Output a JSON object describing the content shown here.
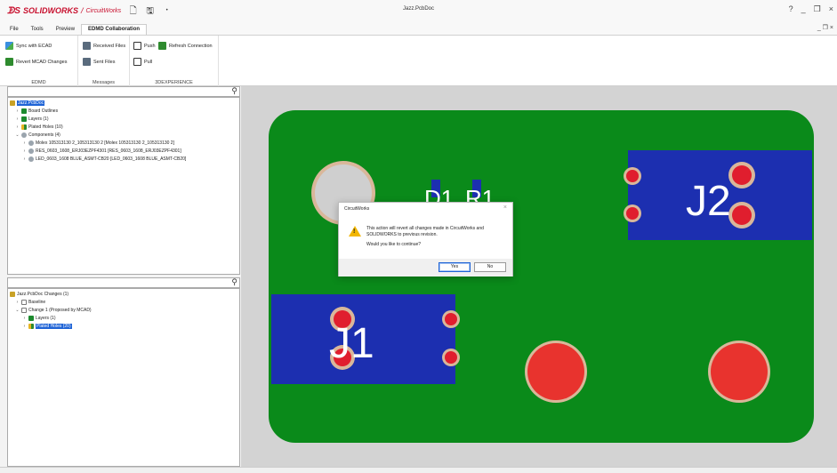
{
  "titlebar": {
    "brand": "SOLIDWORKS",
    "brand_sep": "/",
    "brand_sub": "CircuitWorks",
    "doc_title": "Jazz.PcbDoc",
    "help_glyph": "?",
    "min_glyph": "_",
    "restore_glyph": "❐",
    "close_glyph": "×"
  },
  "menu": {
    "items": [
      "File",
      "Tools",
      "Preview",
      "EDMD Collaboration"
    ],
    "active_index": 3,
    "right_controls": "_ ❐ ×"
  },
  "ribbon": {
    "edmd": {
      "sync": "Sync with ECAD",
      "revert": "Revert MCAD Changes",
      "label": "EDMD"
    },
    "messages": {
      "received": "Received Files",
      "sent": "Sent Files",
      "label": "Messages"
    },
    "exp": {
      "push": "Push",
      "pull": "Pull",
      "refresh": "Refresh Connection",
      "label": "3DEXPERIENCE"
    }
  },
  "tree_top": {
    "root": "Jazz.PcbDoc",
    "nodes": [
      "Board Outlines",
      "Layers (1)",
      "Plated Holes (10)",
      "Components (4)",
      "Molex  105313130 2_105313130 2 [Molex  105313130 2_105313130 2]",
      "RES_0603_1608_ERJ03EZPF4301 [RES_0603_1608_ERJ03EZPF4301]",
      "LED_0603_1608 BLUE_ASMT-CB20 [LED_0603_1608 BLUE_ASMT-CB20]"
    ]
  },
  "tree_bottom": {
    "root": "Jazz.PcbDoc Changes (1)",
    "nodes": [
      "Baseline",
      "Change 1 (Proposed by MCAD)",
      "Layers (1)",
      "Plated Holes (20)"
    ]
  },
  "board": {
    "labels": {
      "d1": "D1",
      "r1": "R1",
      "j1": "J1",
      "j2": "J2"
    },
    "colors": {
      "board": "#0a8a1a",
      "pad": "#1c2fb0",
      "hole": "#e01e2e",
      "ring": "#d9b79a",
      "background": "#d3d3d3"
    }
  },
  "dialog": {
    "title": "CircuitWorks",
    "close": "×",
    "message": "This action will revert all changes made in CircuitWorks and SOLIDWORKS to previous revision.",
    "question": "Would you like to continue?",
    "yes": "Yes",
    "no": "No"
  },
  "icons": [
    "solidworks-logo",
    "search-icon",
    "warning-icon",
    "component-icon",
    "layer-icon",
    "hole-icon"
  ]
}
